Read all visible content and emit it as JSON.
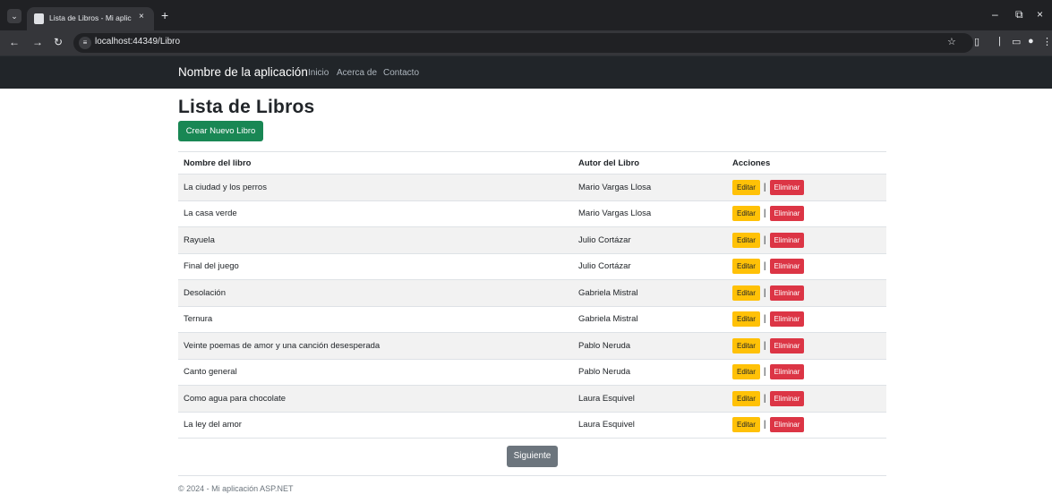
{
  "browser": {
    "tab_menu_icon": "chevron-down-icon",
    "tab_title": "Lista de Libros - Mi aplicación /",
    "tab_close": "×",
    "new_tab": "+",
    "url": "localhost:44349/Libro",
    "controls": {
      "minimize": "–",
      "restore": "⧉",
      "close": "×"
    }
  },
  "navbar": {
    "brand": "Nombre de la aplicación",
    "links": [
      "Inicio",
      "Acerca de",
      "Contacto"
    ]
  },
  "main": {
    "title": "Lista de Libros",
    "create_button": "Crear Nuevo Libro",
    "table": {
      "headers": [
        "Nombre del libro",
        "Autor del Libro",
        "Acciones"
      ],
      "rows": [
        {
          "nombre": "La ciudad y los perros",
          "autor": "Mario Vargas Llosa"
        },
        {
          "nombre": "La casa verde",
          "autor": "Mario Vargas Llosa"
        },
        {
          "nombre": "Rayuela",
          "autor": "Julio Cortázar"
        },
        {
          "nombre": "Final del juego",
          "autor": "Julio Cortázar"
        },
        {
          "nombre": "Desolación",
          "autor": "Gabriela Mistral"
        },
        {
          "nombre": "Ternura",
          "autor": "Gabriela Mistral"
        },
        {
          "nombre": "Veinte poemas de amor y una canción desesperada",
          "autor": "Pablo Neruda"
        },
        {
          "nombre": "Canto general",
          "autor": "Pablo Neruda"
        },
        {
          "nombre": "Como agua para chocolate",
          "autor": "Laura Esquivel"
        },
        {
          "nombre": "La ley del amor",
          "autor": "Laura Esquivel"
        }
      ],
      "edit_label": "Editar",
      "separator": "|",
      "delete_label": "Eliminar"
    },
    "next_button": "Siguiente"
  },
  "footer": {
    "text": "© 2024 - Mi aplicación ASP.NET"
  },
  "colors": {
    "navbar_bg": "#212529",
    "create_button": "#198754",
    "edit_button": "#ffc107",
    "delete_button": "#dc3545",
    "next_button": "#6c757d"
  }
}
